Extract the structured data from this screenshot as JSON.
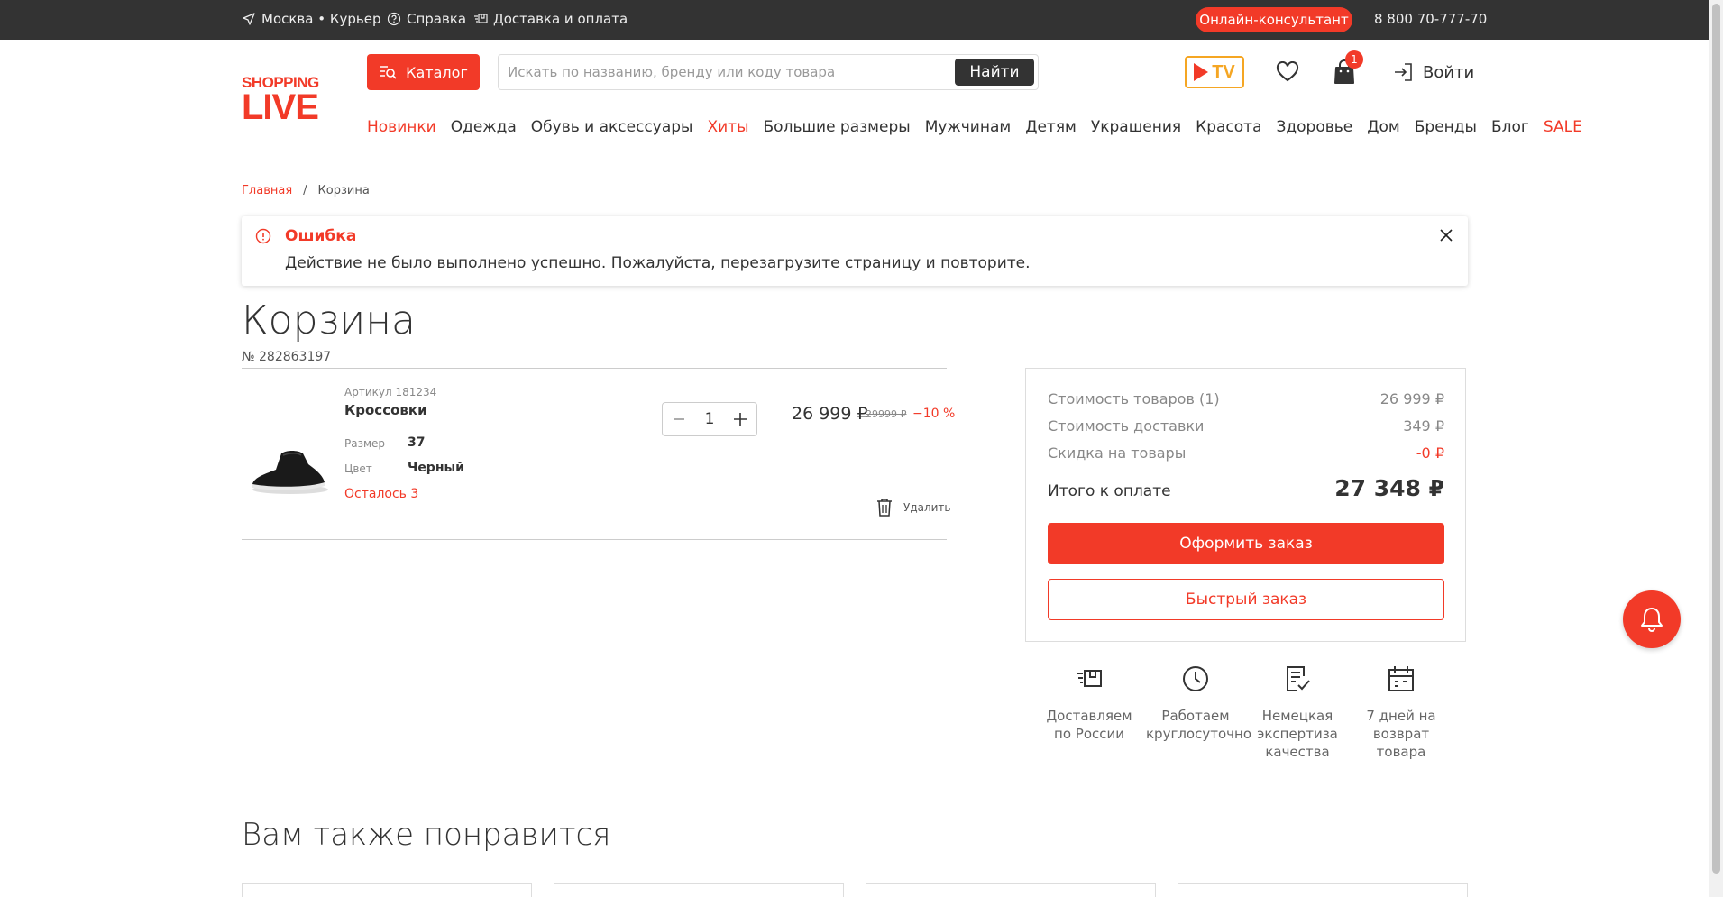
{
  "topbar": {
    "location": "Москва • Курьер",
    "help": "Справка",
    "delivery": "Доставка и оплата",
    "consultant": "Онлайн-консультант",
    "phone": "8 800 70-777-70"
  },
  "header": {
    "logo_top": "SHOPPING",
    "logo_bottom": "LIVE",
    "catalog": "Каталог",
    "search_placeholder": "Искать по названию, бренду или коду товара",
    "search_button": "Найти",
    "tv_label": "TV",
    "cart_count": "1",
    "login": "Войти"
  },
  "nav": [
    {
      "label": "Новинки",
      "highlight": true
    },
    {
      "label": "Одежда",
      "highlight": false
    },
    {
      "label": "Обувь и аксессуары",
      "highlight": false
    },
    {
      "label": "Хиты",
      "highlight": true
    },
    {
      "label": "Большие размеры",
      "highlight": false
    },
    {
      "label": "Мужчинам",
      "highlight": false
    },
    {
      "label": "Детям",
      "highlight": false
    },
    {
      "label": "Украшения",
      "highlight": false
    },
    {
      "label": "Красота",
      "highlight": false
    },
    {
      "label": "Здоровье",
      "highlight": false
    },
    {
      "label": "Дом",
      "highlight": false
    },
    {
      "label": "Бренды",
      "highlight": false
    },
    {
      "label": "Блог",
      "highlight": false
    },
    {
      "label": "SALE",
      "highlight": true
    }
  ],
  "breadcrumb": {
    "home": "Главная",
    "separator": "/",
    "current": "Корзина"
  },
  "alert": {
    "title": "Ошибка",
    "message": "Действие не было выполнено успешно. Пожалуйста, перезагрузите страницу и повторите."
  },
  "cart": {
    "title": "Корзина",
    "order_number": "№ 282863197",
    "item": {
      "sku": "Артикул 181234",
      "name": "Кроссовки",
      "size_label": "Размер",
      "size": "37",
      "color_label": "Цвет",
      "color": "Черный",
      "stock": "Осталось 3",
      "quantity": "1",
      "price": "26 999 ₽",
      "old_price": "29999 ₽",
      "discount": "−10 %",
      "delete": "Удалить"
    }
  },
  "summary": {
    "goods_label": "Стоимость товаров (1)",
    "goods_value": "26 999 ₽",
    "delivery_label": "Стоимость доставки",
    "delivery_value": "349 ₽",
    "discount_label": "Скидка на товары",
    "discount_value": "-0 ₽",
    "total_label": "Итого к оплате",
    "total_value": "27 348 ₽",
    "order_button": "Оформить заказ",
    "fast_button": "Быстрый заказ"
  },
  "features": [
    {
      "line1": "Доставляем",
      "line2": "по России",
      "line3": ""
    },
    {
      "line1": "Работаем",
      "line2": "круглосуточно",
      "line3": ""
    },
    {
      "line1": "Немецкая",
      "line2": "экспертиза",
      "line3": "качества"
    },
    {
      "line1": "7 дней на",
      "line2": "возврат",
      "line3": "товара"
    }
  ],
  "recommend": {
    "title": "Вам также понравится"
  },
  "colors": {
    "accent": "#f23a28",
    "topbar": "#333333",
    "tv_orange": "#f5a623"
  }
}
